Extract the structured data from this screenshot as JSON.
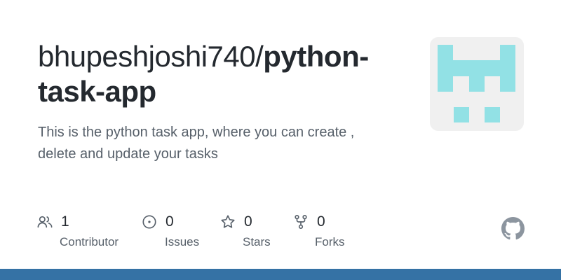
{
  "repo": {
    "owner": "bhupeshjoshi740/",
    "name_line1": "python-",
    "name_line2": "task-app",
    "description_line1": "This is the python task app, where you can create ,",
    "description_line2": "delete and update your tasks"
  },
  "stats": {
    "contributors": {
      "value": "1",
      "label": "Contributor",
      "icon": "people-icon"
    },
    "issues": {
      "value": "0",
      "label": "Issues",
      "icon": "issue-opened-icon"
    },
    "stars": {
      "value": "0",
      "label": "Stars",
      "icon": "star-icon"
    },
    "forks": {
      "value": "0",
      "label": "Forks",
      "icon": "repo-forked-icon"
    }
  },
  "icons": {
    "avatar": "identicon-avatar",
    "brand": "github-mark-icon"
  },
  "colors": {
    "title": "#24292f",
    "muted": "#57606a",
    "icon": "#57606a",
    "identicon": "#92e1e5",
    "avatar_bg": "#f0f0f0",
    "github_mark": "#8c959f",
    "bottom_bar": "#3572a5"
  }
}
